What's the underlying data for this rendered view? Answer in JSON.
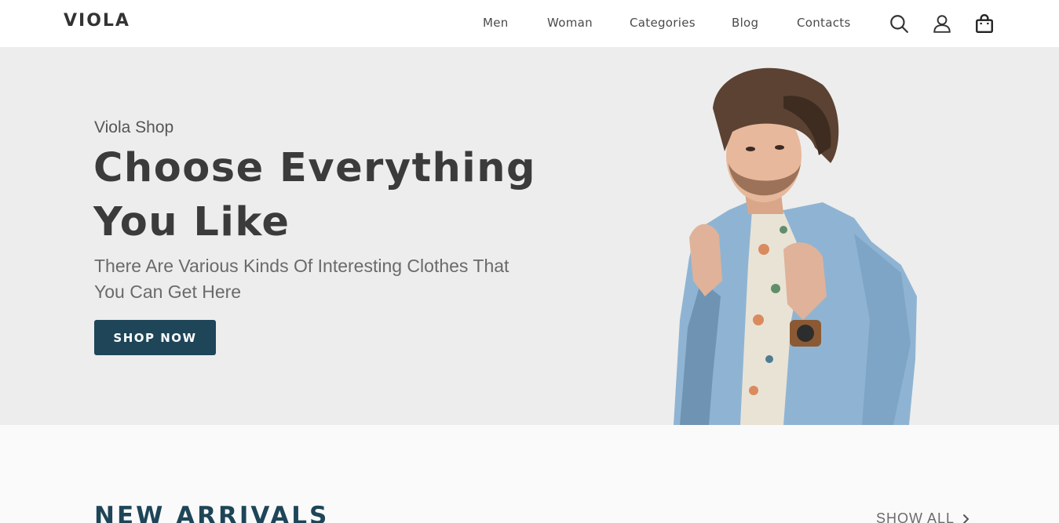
{
  "header": {
    "logo": "VIOLA",
    "nav": [
      {
        "label": "Men"
      },
      {
        "label": "Woman"
      },
      {
        "label": "Categories"
      },
      {
        "label": "Blog"
      },
      {
        "label": "Contacts"
      }
    ],
    "icons": [
      "search-icon",
      "user-icon",
      "shopping-bag-icon"
    ]
  },
  "hero": {
    "eyebrow": "Viola Shop",
    "headline_line1": "Choose Everything",
    "headline_line2": "You Like",
    "subtext": "There Are Various Kinds Of Interesting Clothes That You Can Get Here",
    "cta_label": "SHOP NOW",
    "background": "#ededed",
    "cta_color": "#1e4558"
  },
  "arrivals": {
    "title": "NEW ARRIVALS",
    "show_all_label": "SHOW ALL"
  }
}
